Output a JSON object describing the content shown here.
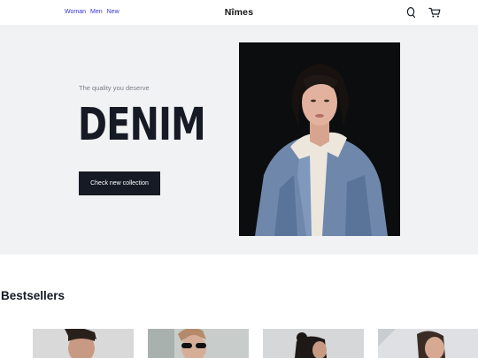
{
  "header": {
    "nav": [
      {
        "label": "Woman"
      },
      {
        "label": "Men"
      },
      {
        "label": "New"
      }
    ],
    "brand": "Nîmes",
    "icons": [
      "search-icon",
      "cart-icon"
    ]
  },
  "hero": {
    "tagline": "The quality you deserve",
    "headline": "DENIM",
    "cta_label": "Check new collection",
    "image": "woman-in-denim-jacket-photo"
  },
  "bestsellers": {
    "title": "Bestsellers",
    "products": [
      {
        "image": "man-portrait-photo"
      },
      {
        "image": "woman-sunglasses-photo"
      },
      {
        "image": "woman-hair-bun-photo"
      },
      {
        "image": "woman-portrait-photo"
      }
    ]
  },
  "colors": {
    "hero_bg": "#f1f2f4",
    "dark": "#151a24",
    "nav_link": "#3535d8"
  }
}
